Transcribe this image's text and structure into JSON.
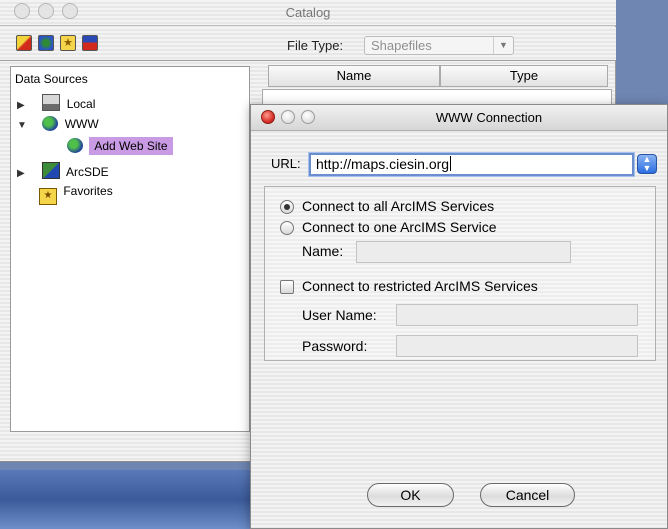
{
  "catalog": {
    "title": "Catalog",
    "file_type_label": "File Type:",
    "file_type_value": "Shapefiles",
    "toolbar_icons": [
      "connect-icon",
      "refresh-icon",
      "favorite-icon",
      "export-icon"
    ],
    "tree": {
      "header": "Data Sources",
      "items": [
        {
          "label": "Local",
          "icon": "computer-icon",
          "expanded": false
        },
        {
          "label": "WWW",
          "icon": "globe-icon",
          "expanded": true
        },
        {
          "label": "Add Web Site",
          "icon": "globe-icon",
          "selected": true
        },
        {
          "label": "ArcSDE",
          "icon": "database-icon",
          "expanded": false
        },
        {
          "label": "Favorites",
          "icon": "star-folder-icon"
        }
      ]
    },
    "columns": [
      "Name",
      "Type"
    ]
  },
  "dialog": {
    "title": "WWW Connection",
    "url_label": "URL:",
    "url_value": "http://maps.ciesin.org",
    "radio_all": "Connect to all ArcIMS Services",
    "radio_one": "Connect to one ArcIMS Service",
    "name_label": "Name:",
    "restricted_label": "Connect to restricted ArcIMS Services",
    "username_label": "User Name:",
    "password_label": "Password:",
    "ok_label": "OK",
    "cancel_label": "Cancel"
  },
  "colors": {
    "selection": "#c99be4",
    "focus_ring": "#6b8fcc",
    "desktop": "#3b5a99"
  }
}
